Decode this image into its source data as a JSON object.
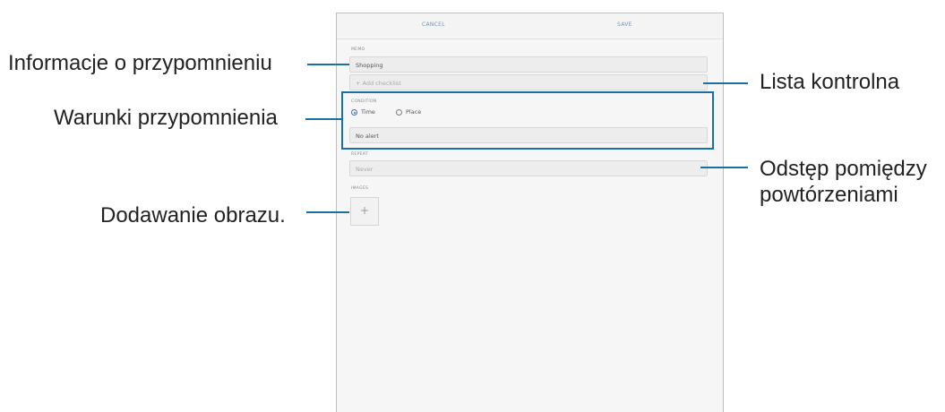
{
  "screen": {
    "topbar": {
      "cancel_label": "CANCEL",
      "save_label": "SAVE"
    },
    "memo": {
      "section_label": "MEMO",
      "value": "Shopping",
      "add_checklist": "+ Add checklist"
    },
    "condition": {
      "section_label": "CONDITION",
      "options": [
        "Time",
        "Place"
      ],
      "selected": "Time",
      "alert_value": "No alert"
    },
    "repeat": {
      "section_label": "REPEAT",
      "value": "Never"
    },
    "images": {
      "section_label": "IMAGES",
      "add_button": "+"
    }
  },
  "callouts": {
    "left": {
      "reminder_info": "Informacje o przypomnieniu",
      "reminder_conditions": "Warunki przypomnienia",
      "add_image": "Dodawanie obrazu."
    },
    "right": {
      "checklist": "Lista kontrolna",
      "repeat_interval_line1": "Odstęp pomiędzy",
      "repeat_interval_line2": "powtórzeniami"
    }
  },
  "colors": {
    "accent": "#1a6fa4",
    "topbar_text": "#7892b0"
  }
}
